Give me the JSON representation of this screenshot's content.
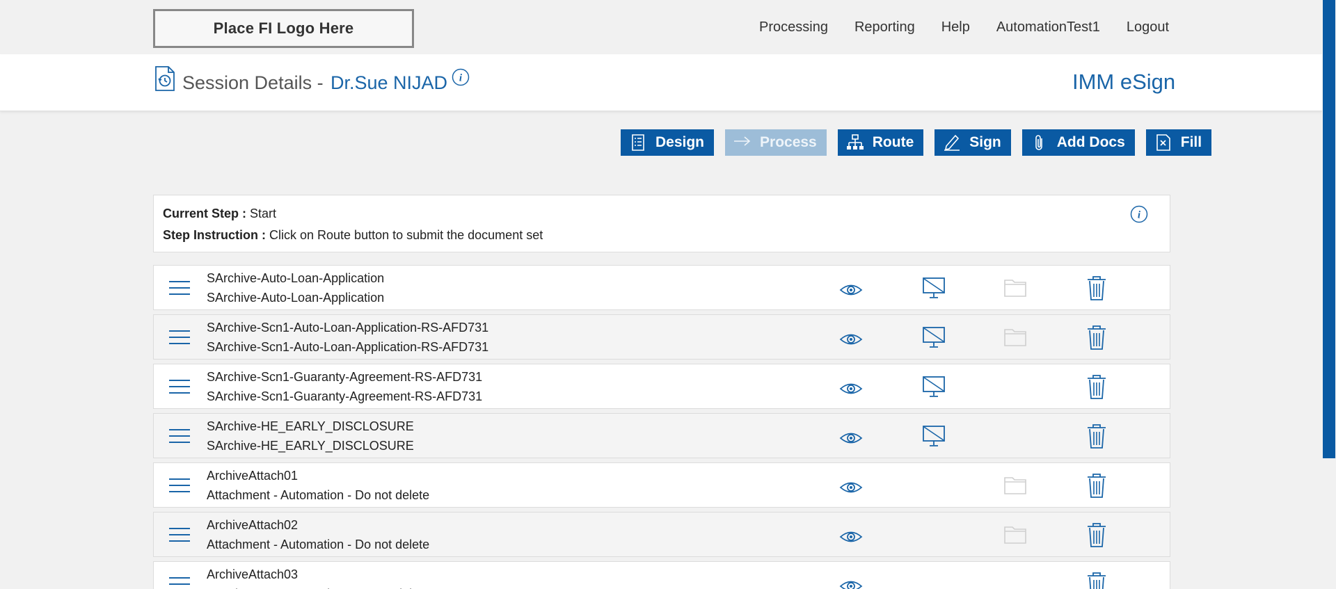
{
  "topbar": {
    "logo_text": "Place FI Logo Here",
    "nav": [
      "Processing",
      "Reporting",
      "Help",
      "AutomationTest1",
      "Logout"
    ]
  },
  "header": {
    "title": "Session Details -",
    "name": "Dr.Sue NIJAD",
    "brand": "IMM eSign"
  },
  "toolbar": {
    "buttons": [
      {
        "label": "Design",
        "icon": "checklist-icon",
        "enabled": true
      },
      {
        "label": "Process",
        "icon": "arrow-right-icon",
        "enabled": false
      },
      {
        "label": "Route",
        "icon": "org-chart-icon",
        "enabled": true
      },
      {
        "label": "Sign",
        "icon": "pen-icon",
        "enabled": true
      },
      {
        "label": "Add Docs",
        "icon": "paperclip-icon",
        "enabled": true
      },
      {
        "label": "Fill",
        "icon": "form-fill-icon",
        "enabled": true
      }
    ]
  },
  "step": {
    "current_label": "Current Step :",
    "current_value": " Start",
    "instruction_label": "Step Instruction :",
    "instruction_value": " Click on Route button to submit the document set"
  },
  "documents": [
    {
      "title": "SArchive-Auto-Loan-Application",
      "subtitle": "SArchive-Auto-Loan-Application",
      "monitor": true,
      "folder": true
    },
    {
      "title": "SArchive-Scn1-Auto-Loan-Application-RS-AFD731",
      "subtitle": "SArchive-Scn1-Auto-Loan-Application-RS-AFD731",
      "monitor": true,
      "folder": true
    },
    {
      "title": "SArchive-Scn1-Guaranty-Agreement-RS-AFD731",
      "subtitle": "SArchive-Scn1-Guaranty-Agreement-RS-AFD731",
      "monitor": true,
      "folder": false
    },
    {
      "title": "SArchive-HE_EARLY_DISCLOSURE",
      "subtitle": "SArchive-HE_EARLY_DISCLOSURE",
      "monitor": true,
      "folder": false
    },
    {
      "title": "ArchiveAttach01",
      "subtitle": "Attachment - Automation - Do not delete",
      "monitor": false,
      "folder": true
    },
    {
      "title": "ArchiveAttach02",
      "subtitle": "Attachment - Automation - Do not delete",
      "monitor": false,
      "folder": true
    },
    {
      "title": "ArchiveAttach03",
      "subtitle": "Attachment - Automation - Do not delete",
      "monitor": false,
      "folder": false
    }
  ],
  "colors": {
    "accent": "#0a5aa3",
    "accent_disabled": "#9dbdd8",
    "link": "#1a65a8"
  }
}
